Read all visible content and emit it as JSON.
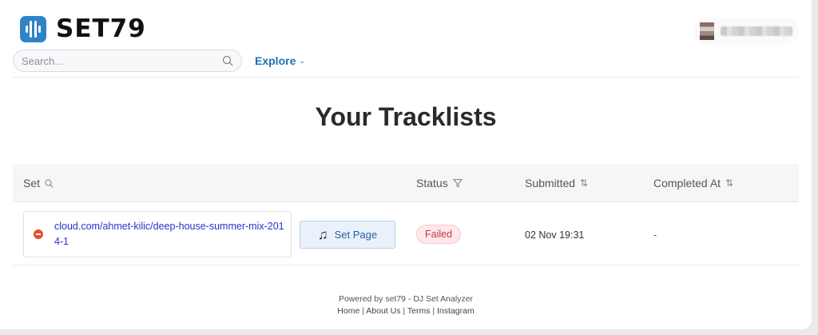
{
  "brand": {
    "name": "SET79"
  },
  "user": {
    "name_display": ""
  },
  "search": {
    "placeholder": "Search..."
  },
  "nav": {
    "explore_label": "Explore"
  },
  "page": {
    "title": "Your Tracklists"
  },
  "table": {
    "columns": {
      "set": "Set",
      "status": "Status",
      "submitted": "Submitted",
      "completed": "Completed At"
    },
    "rows": [
      {
        "set_url": "cloud.com/ahmet-kilic/deep-house-summer-mix-2014-1",
        "set_page_label": "Set Page",
        "status": "Failed",
        "submitted": "02 Nov 19:31",
        "completed": "-"
      }
    ]
  },
  "footer": {
    "powered_by": "Powered by set79 - DJ Set Analyzer",
    "links": [
      "Home",
      "About Us",
      "Terms",
      "Instagram"
    ]
  },
  "colors": {
    "brand_blue": "#2f84c6",
    "link_blue": "#2535c9",
    "failed_red": "#c23a44"
  }
}
